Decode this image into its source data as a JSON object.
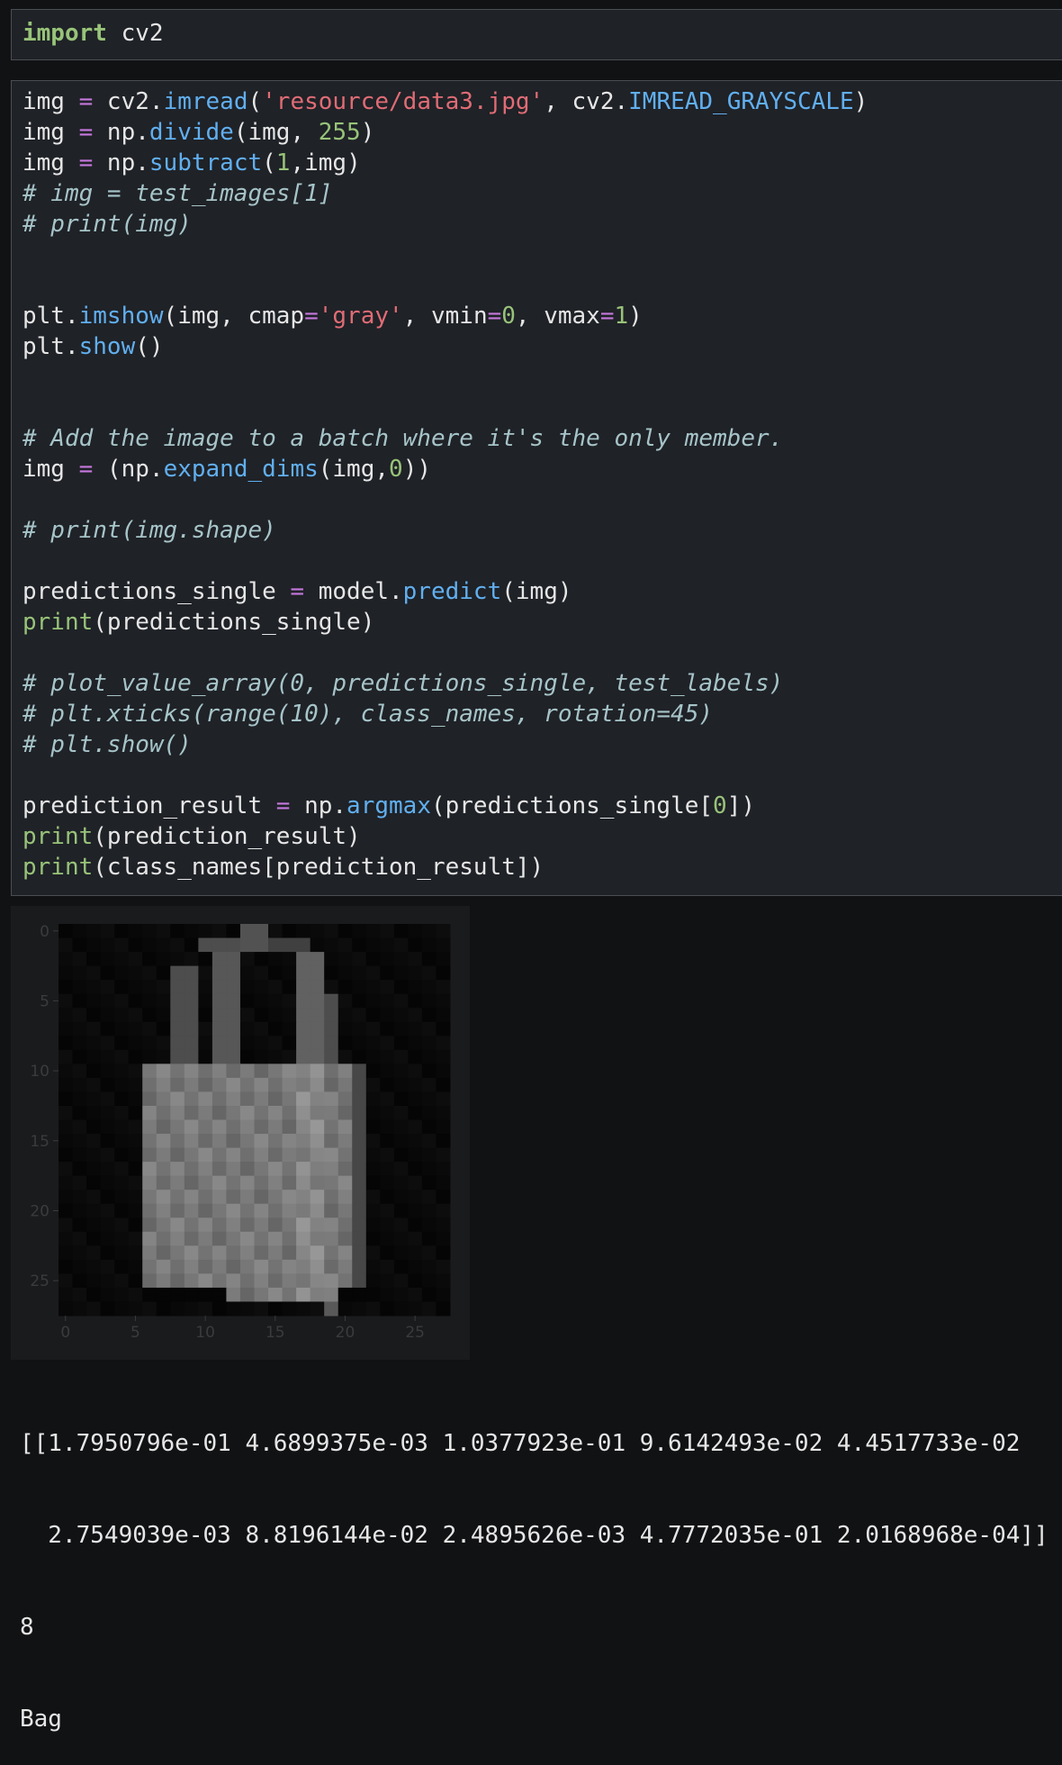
{
  "cell1": {
    "lines": [
      [
        [
          "kw-green",
          "import"
        ],
        [
          "pl",
          " cv2"
        ]
      ]
    ]
  },
  "cell2": {
    "lines": [
      [
        [
          "pl",
          "img "
        ],
        [
          "op",
          "="
        ],
        [
          "pl",
          " cv2."
        ],
        [
          "fn",
          "imread"
        ],
        [
          "pl",
          "("
        ],
        [
          "str",
          "'resource/data3.jpg'"
        ],
        [
          "pl",
          ", cv2."
        ],
        [
          "fn",
          "IMREAD_GRAYSCALE"
        ],
        [
          "pl",
          ")"
        ]
      ],
      [
        [
          "pl",
          "img "
        ],
        [
          "op",
          "="
        ],
        [
          "pl",
          " np."
        ],
        [
          "fn",
          "divide"
        ],
        [
          "pl",
          "(img, "
        ],
        [
          "num",
          "255"
        ],
        [
          "pl",
          ")"
        ]
      ],
      [
        [
          "pl",
          "img "
        ],
        [
          "op",
          "="
        ],
        [
          "pl",
          " np."
        ],
        [
          "fn",
          "subtract"
        ],
        [
          "pl",
          "("
        ],
        [
          "num",
          "1"
        ],
        [
          "pl",
          ",img)"
        ]
      ],
      [
        [
          "cm",
          "# img = test_images[1]"
        ]
      ],
      [
        [
          "cm",
          "# print(img)"
        ]
      ],
      [],
      [],
      [
        [
          "pl",
          "plt."
        ],
        [
          "fn",
          "imshow"
        ],
        [
          "pl",
          "(img, cmap"
        ],
        [
          "op",
          "="
        ],
        [
          "str",
          "'gray'"
        ],
        [
          "pl",
          ", vmin"
        ],
        [
          "op",
          "="
        ],
        [
          "num",
          "0"
        ],
        [
          "pl",
          ", vmax"
        ],
        [
          "op",
          "="
        ],
        [
          "num",
          "1"
        ],
        [
          "pl",
          ")"
        ]
      ],
      [
        [
          "pl",
          "plt."
        ],
        [
          "fn",
          "show"
        ],
        [
          "pl",
          "()"
        ]
      ],
      [],
      [],
      [
        [
          "cm",
          "# Add the image to a batch where it's the only member."
        ]
      ],
      [
        [
          "pl",
          "img "
        ],
        [
          "op",
          "="
        ],
        [
          "pl",
          " (np."
        ],
        [
          "fn",
          "expand_dims"
        ],
        [
          "pl",
          "(img,"
        ],
        [
          "num",
          "0"
        ],
        [
          "pl",
          "))"
        ]
      ],
      [],
      [
        [
          "cm",
          "# print(img.shape)"
        ]
      ],
      [],
      [
        [
          "pl",
          "predictions_single "
        ],
        [
          "op",
          "="
        ],
        [
          "pl",
          " model."
        ],
        [
          "fn",
          "predict"
        ],
        [
          "pl",
          "(img)"
        ]
      ],
      [
        [
          "num",
          "print"
        ],
        [
          "pl",
          "(predictions_single)"
        ]
      ],
      [],
      [
        [
          "cm",
          "# plot_value_array(0, predictions_single, test_labels)"
        ]
      ],
      [
        [
          "cm",
          "# plt.xticks(range(10), class_names, rotation=45)"
        ]
      ],
      [
        [
          "cm",
          "# plt.show()"
        ]
      ],
      [],
      [
        [
          "pl",
          "prediction_result "
        ],
        [
          "op",
          "="
        ],
        [
          "pl",
          " np."
        ],
        [
          "fn",
          "argmax"
        ],
        [
          "pl",
          "(predictions_single["
        ],
        [
          "num",
          "0"
        ],
        [
          "pl",
          "])"
        ]
      ],
      [
        [
          "num",
          "print"
        ],
        [
          "pl",
          "(prediction_result)"
        ]
      ],
      [
        [
          "num",
          "print"
        ],
        [
          "pl",
          "(class_names[prediction_result])"
        ]
      ]
    ]
  },
  "figure": {
    "x_ticks": [
      "0",
      "5",
      "10",
      "15",
      "20",
      "25"
    ],
    "y_ticks": [
      "0",
      "5",
      "10",
      "15",
      "20",
      "25"
    ],
    "image_rows": 28,
    "image_cols": 28
  },
  "output": {
    "line1": "[[1.7950796e-01 4.6899375e-03 1.0377923e-01 9.6142493e-02 4.4517733e-02",
    "line2": "  2.7549039e-03 8.8196144e-02 2.4895626e-03 4.7772035e-01 2.0168968e-04]]",
    "line3": "8",
    "line4": "Bag"
  }
}
